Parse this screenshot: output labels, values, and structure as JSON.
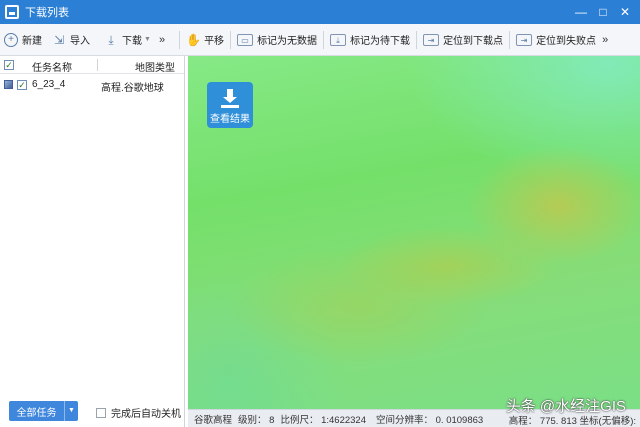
{
  "window": {
    "title": "下载列表",
    "controls": [
      "—",
      "□",
      "✕"
    ]
  },
  "toolbar": {
    "new_label": "新建",
    "import_label": "导入",
    "download_label": "下载",
    "more_label": "»",
    "pan_label": "平移",
    "mark_nodata_label": "标记为无数据",
    "mark_pending_label": "标记为待下载",
    "locate_download_label": "定位到下载点",
    "locate_fail_label": "定位到失败点",
    "more2_label": "»"
  },
  "task_list": {
    "col_name": "任务名称",
    "col_type": "地图类型",
    "rows": [
      {
        "checked": true,
        "name": "6_23_4",
        "type": "高程.谷歌地球"
      }
    ]
  },
  "footer": {
    "all_tasks_label": "全部任务",
    "shutdown_label": "完成后自动关机"
  },
  "map": {
    "view_result_label": "查看结果",
    "colors": {
      "low": "#74e06a",
      "high": "#c8c850",
      "accent": "#2f8fd8"
    }
  },
  "statusbar": {
    "map_type": "谷歌高程",
    "level": "级别：  8",
    "scale": "比例尺：  1:4622324",
    "resolution": "空间分辨率：  0. 0109863",
    "elevation": "高程：  775. 813  坐标(无偏移):"
  },
  "watermark": "头条 @水经注GIS"
}
